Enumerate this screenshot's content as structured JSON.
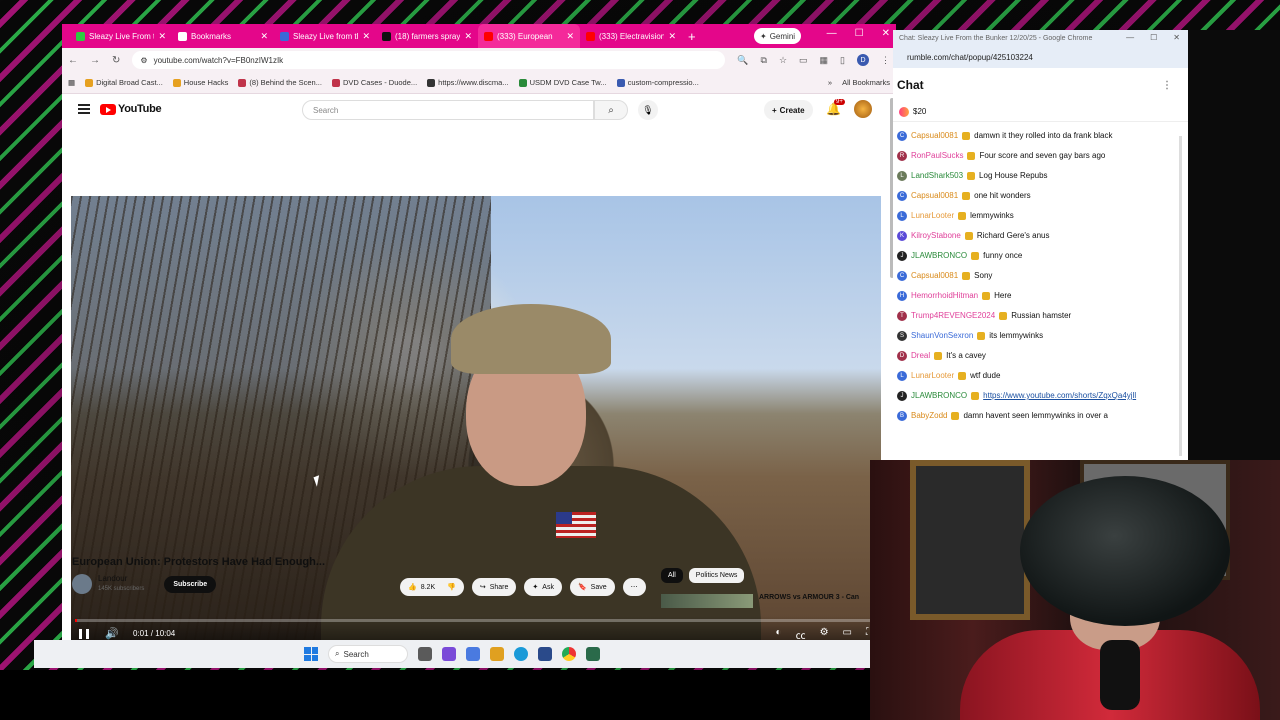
{
  "browser": {
    "tabs": [
      {
        "label": "Sleazy Live From th",
        "color": "#2ecc40"
      },
      {
        "label": "Bookmarks",
        "color": "#ffffff"
      },
      {
        "label": "Sleazy Live from th",
        "color": "#3a6ad8"
      },
      {
        "label": "(18) farmers spray",
        "color": "#111111"
      },
      {
        "label": "(333) European",
        "color": "#ff0000"
      },
      {
        "label": "(333) Electravision",
        "color": "#ff0000"
      }
    ],
    "gemini_label": "Gemini",
    "url": "youtube.com/watch?v=FB0nzIW1zIk",
    "profile_initial": "D",
    "bookmarks": [
      "Digital Broad Cast...",
      "House Hacks",
      "(8) Behind the Scen...",
      "DVD Cases - Duode...",
      "https://www.discma...",
      "USDM DVD Case Tw...",
      "custom-compressio..."
    ],
    "all_bookmarks": "All Bookmarks"
  },
  "youtube": {
    "logo": "YouTube",
    "search_placeholder": "Search",
    "create_label": "Create",
    "notif_count": "9+",
    "video_time": "0:01 / 10:04",
    "progress": 0.002,
    "video_title": "European Union: Protestors Have Had Enough...",
    "channel_name": "Landour",
    "channel_subs": "145K subscribers",
    "subscribe_label": "Subscribe",
    "likes": "8.2K",
    "share_label": "Share",
    "ask_label": "Ask",
    "save_label": "Save",
    "chips": [
      "All",
      "Politics News"
    ],
    "rec_title": "ARROWS vs ARMOUR 3 - Can"
  },
  "taskbar": {
    "search_label": "Search"
  },
  "chat": {
    "window_title": "Chat: Sleazy Live From the Bunker 12/20/25 - Google Chrome",
    "url": "rumble.com/chat/popup/425103224",
    "heading": "Chat",
    "rant_amount": "$20",
    "messages": [
      {
        "user": "Capsual0081",
        "text": "damwn it they rolled into da frank black",
        "color": "#3a6ad8",
        "ucolor": "#d98a1a",
        "initial": "C"
      },
      {
        "user": "RonPaulSucks",
        "text": "Four score and seven gay bars ago",
        "color": "#a0304a",
        "ucolor": "#e0409a",
        "initial": "R"
      },
      {
        "user": "LandShark503",
        "text": "Log House Repubs",
        "color": "#6a7a5a",
        "ucolor": "#2a8a3a",
        "initial": "L"
      },
      {
        "user": "Capsual0081",
        "text": "one hit wonders",
        "color": "#3a6ad8",
        "ucolor": "#d98a1a",
        "initial": "C"
      },
      {
        "user": "LunarLooter",
        "text": "lemmywinks",
        "color": "#3a6ad8",
        "ucolor": "#e69a3a",
        "initial": "L"
      },
      {
        "user": "KilroyStabone",
        "text": "Richard Gere's anus",
        "color": "#5a4ad8",
        "ucolor": "#e0409a",
        "initial": "K"
      },
      {
        "user": "JLAWBRONCO",
        "text": "funny once",
        "color": "#222222",
        "ucolor": "#2a8a3a",
        "initial": "J"
      },
      {
        "user": "Capsual0081",
        "text": "Sony",
        "color": "#3a6ad8",
        "ucolor": "#d98a1a",
        "initial": "C"
      },
      {
        "user": "HemorrhoidHitman",
        "text": "Here",
        "color": "#3a6ad8",
        "ucolor": "#e0409a",
        "initial": "H"
      },
      {
        "user": "Trump4REVENGE2024",
        "text": "Russian hamster",
        "color": "#a0304a",
        "ucolor": "#e0409a",
        "initial": "T"
      },
      {
        "user": "ShaunVonSexron",
        "text": "its lemmywinks",
        "color": "#333333",
        "ucolor": "#3a6ad8",
        "initial": "S"
      },
      {
        "user": "Dreal",
        "text": "It's a cavey",
        "color": "#a0304a",
        "ucolor": "#e0409a",
        "initial": "D"
      },
      {
        "user": "LunarLooter",
        "text": "wtf dude",
        "color": "#3a6ad8",
        "ucolor": "#e69a3a",
        "initial": "L"
      },
      {
        "user": "JLAWBRONCO",
        "text": "https://www.youtube.com/shorts/ZqxQa4yjll",
        "color": "#222222",
        "ucolor": "#2a8a3a",
        "initial": "J",
        "link": true
      },
      {
        "user": "BabyZodd",
        "text": "damn havent seen lemmywinks in over a",
        "color": "#3a6ad8",
        "ucolor": "#d98a1a",
        "initial": "B"
      }
    ]
  }
}
